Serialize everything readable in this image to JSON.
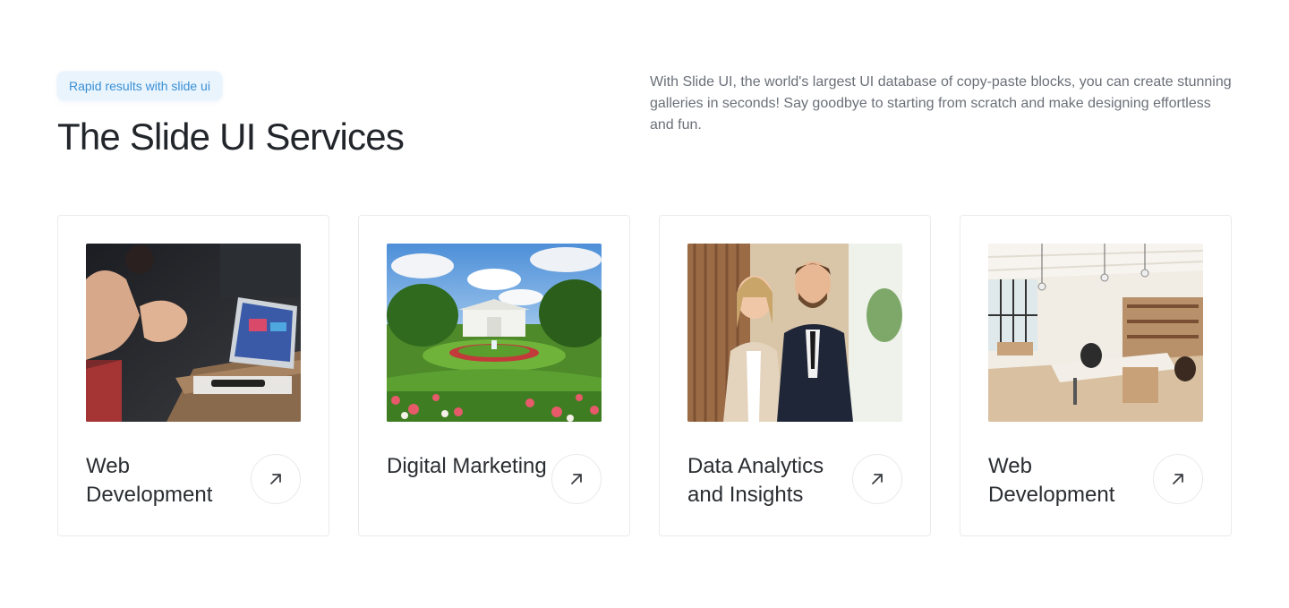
{
  "header": {
    "badge": "Rapid results with slide ui",
    "title": "The Slide UI Services",
    "description": "With Slide UI, the world's largest UI database of copy-paste blocks, you can create stunning galleries in seconds! Say goodbye to starting from scratch and make designing effortless and fun."
  },
  "services": [
    {
      "title": "Web Development",
      "image": "team-meeting-laptop-photo",
      "icon": "arrow-up-right-icon"
    },
    {
      "title": "Digital Marketing",
      "image": "white-house-garden-photo",
      "icon": "arrow-up-right-icon"
    },
    {
      "title": "Data Analytics and Insights",
      "image": "business-people-portrait-photo",
      "icon": "arrow-up-right-icon"
    },
    {
      "title": "Web Development",
      "image": "modern-office-interior-photo",
      "icon": "arrow-up-right-icon"
    }
  ],
  "colors": {
    "badge_bg": "#e9f4fd",
    "badge_text": "#3a8fd6",
    "title": "#22262b",
    "description": "#6b7078",
    "card_border": "#e9ebee"
  }
}
